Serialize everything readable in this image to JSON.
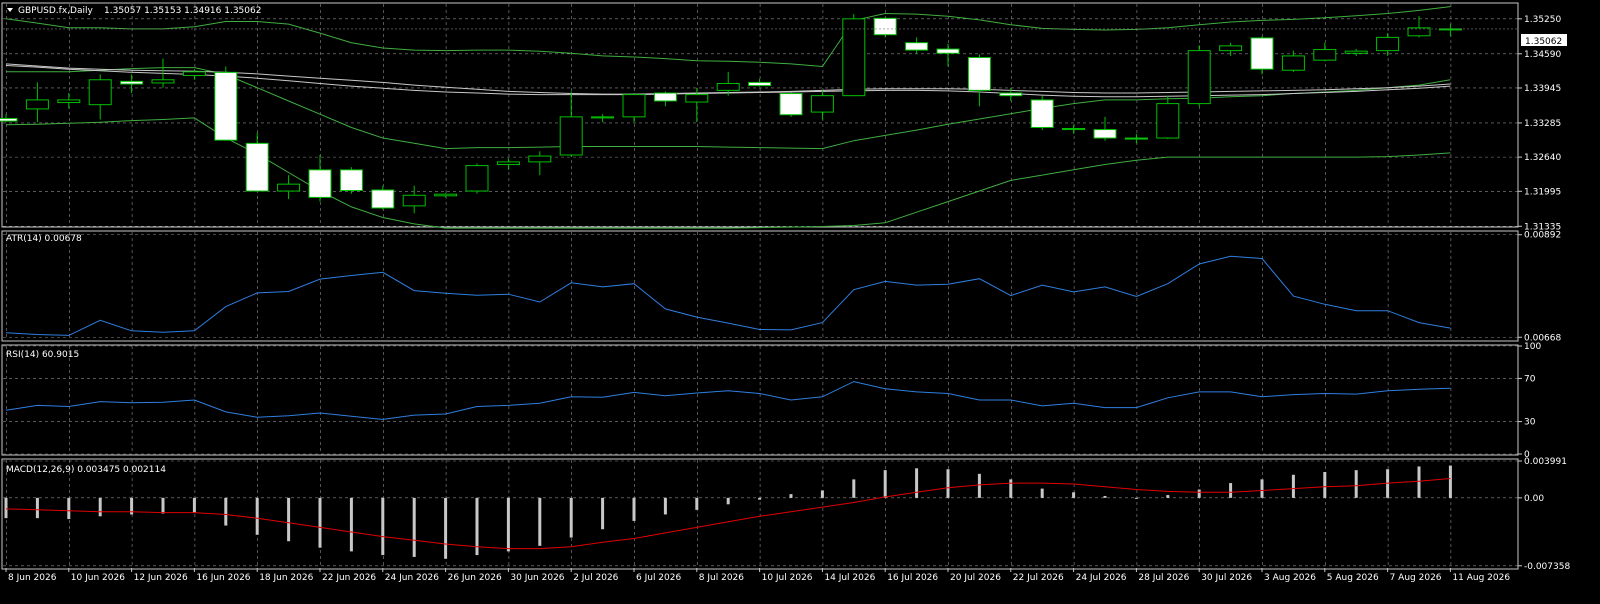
{
  "symbol_header": "GBPUSD.fx,Daily",
  "ohlc_header": "1.35057 1.35153 1.34916 1.35062",
  "current_price_label": "1.35062",
  "colors": {
    "background": "#000000",
    "grid": "#8c8c8c",
    "frame": "#c8c8c8",
    "bull": "#000000",
    "bear": "#ffffff",
    "candle_line": "#00c000",
    "band": "#3fae3f",
    "ma_slow": "#c8c8c8",
    "atr": "#2f7fe0",
    "rsi": "#2f7fe0",
    "macd_hist": "#c8c8c8",
    "macd_signal": "#e00000",
    "text": "#ffffff"
  },
  "chart_data": [
    {
      "type": "candlestick",
      "name": "price",
      "title": "GBPUSD.fx,Daily",
      "y_ticks": [
        "1.35250",
        "1.34590",
        "1.33945",
        "1.33285",
        "1.32640",
        "1.31995",
        "1.31335"
      ],
      "ylim": [
        1.3134,
        1.3553
      ],
      "grid": true,
      "candles": [
        {
          "o": 1.3337,
          "h": 1.3345,
          "l": 1.333,
          "c": 1.3332
        },
        {
          "o": 1.3355,
          "h": 1.3405,
          "l": 1.333,
          "c": 1.3372
        },
        {
          "o": 1.3367,
          "h": 1.3385,
          "l": 1.3356,
          "c": 1.3372
        },
        {
          "o": 1.3363,
          "h": 1.342,
          "l": 1.3335,
          "c": 1.341
        },
        {
          "o": 1.3407,
          "h": 1.342,
          "l": 1.3385,
          "c": 1.3402
        },
        {
          "o": 1.3404,
          "h": 1.345,
          "l": 1.3395,
          "c": 1.341
        },
        {
          "o": 1.3418,
          "h": 1.343,
          "l": 1.341,
          "c": 1.3425
        },
        {
          "o": 1.3424,
          "h": 1.3435,
          "l": 1.3408,
          "c": 1.3296
        },
        {
          "o": 1.329,
          "h": 1.331,
          "l": 1.3225,
          "c": 1.32
        },
        {
          "o": 1.32,
          "h": 1.323,
          "l": 1.3185,
          "c": 1.3213
        },
        {
          "o": 1.324,
          "h": 1.3268,
          "l": 1.318,
          "c": 1.3188
        },
        {
          "o": 1.324,
          "h": 1.3245,
          "l": 1.3195,
          "c": 1.3201
        },
        {
          "o": 1.3202,
          "h": 1.321,
          "l": 1.3165,
          "c": 1.3168
        },
        {
          "o": 1.3172,
          "h": 1.321,
          "l": 1.3158,
          "c": 1.3192
        },
        {
          "o": 1.3191,
          "h": 1.3196,
          "l": 1.3188,
          "c": 1.3194
        },
        {
          "o": 1.32,
          "h": 1.3252,
          "l": 1.3195,
          "c": 1.3248
        },
        {
          "o": 1.325,
          "h": 1.3262,
          "l": 1.324,
          "c": 1.3255
        },
        {
          "o": 1.3255,
          "h": 1.3275,
          "l": 1.323,
          "c": 1.3266
        },
        {
          "o": 1.3268,
          "h": 1.3388,
          "l": 1.3265,
          "c": 1.334
        },
        {
          "o": 1.3338,
          "h": 1.3345,
          "l": 1.333,
          "c": 1.334
        },
        {
          "o": 1.334,
          "h": 1.3385,
          "l": 1.333,
          "c": 1.3382
        },
        {
          "o": 1.3385,
          "h": 1.3388,
          "l": 1.336,
          "c": 1.337
        },
        {
          "o": 1.3368,
          "h": 1.3395,
          "l": 1.333,
          "c": 1.3382
        },
        {
          "o": 1.339,
          "h": 1.3425,
          "l": 1.338,
          "c": 1.3403
        },
        {
          "o": 1.3405,
          "h": 1.3412,
          "l": 1.3397,
          "c": 1.3399
        },
        {
          "o": 1.3384,
          "h": 1.3386,
          "l": 1.334,
          "c": 1.3344
        },
        {
          "o": 1.3349,
          "h": 1.339,
          "l": 1.3335,
          "c": 1.338
        },
        {
          "o": 1.338,
          "h": 1.3534,
          "l": 1.3379,
          "c": 1.3525
        },
        {
          "o": 1.3526,
          "h": 1.3528,
          "l": 1.349,
          "c": 1.3495
        },
        {
          "o": 1.348,
          "h": 1.349,
          "l": 1.346,
          "c": 1.3466
        },
        {
          "o": 1.3468,
          "h": 1.3478,
          "l": 1.3435,
          "c": 1.346
        },
        {
          "o": 1.3452,
          "h": 1.3458,
          "l": 1.336,
          "c": 1.339
        },
        {
          "o": 1.3385,
          "h": 1.3395,
          "l": 1.337,
          "c": 1.338
        },
        {
          "o": 1.3372,
          "h": 1.338,
          "l": 1.3315,
          "c": 1.332
        },
        {
          "o": 1.3316,
          "h": 1.3325,
          "l": 1.3308,
          "c": 1.3318
        },
        {
          "o": 1.3316,
          "h": 1.334,
          "l": 1.3295,
          "c": 1.33
        },
        {
          "o": 1.33,
          "h": 1.3308,
          "l": 1.329,
          "c": 1.3298
        },
        {
          "o": 1.33,
          "h": 1.338,
          "l": 1.3298,
          "c": 1.3365
        },
        {
          "o": 1.3365,
          "h": 1.3475,
          "l": 1.336,
          "c": 1.3465
        },
        {
          "o": 1.3465,
          "h": 1.348,
          "l": 1.3455,
          "c": 1.3474
        },
        {
          "o": 1.3489,
          "h": 1.3492,
          "l": 1.342,
          "c": 1.343
        },
        {
          "o": 1.3428,
          "h": 1.3465,
          "l": 1.3425,
          "c": 1.3455
        },
        {
          "o": 1.3447,
          "h": 1.348,
          "l": 1.3445,
          "c": 1.3467
        },
        {
          "o": 1.346,
          "h": 1.3468,
          "l": 1.3455,
          "c": 1.3464
        },
        {
          "o": 1.3465,
          "h": 1.3498,
          "l": 1.3455,
          "c": 1.349
        },
        {
          "o": 1.3493,
          "h": 1.353,
          "l": 1.349,
          "c": 1.3508
        },
        {
          "o": 1.3506,
          "h": 1.3515,
          "l": 1.3492,
          "c": 1.3506
        }
      ],
      "bands": {
        "upper": [
          1.3525,
          1.3517,
          1.3508,
          1.3508,
          1.3506,
          1.3506,
          1.351,
          1.352,
          1.352,
          1.3515,
          1.3498,
          1.348,
          1.347,
          1.3466,
          1.3465,
          1.3466,
          1.3466,
          1.3464,
          1.346,
          1.3455,
          1.3453,
          1.345,
          1.3446,
          1.3445,
          1.3443,
          1.344,
          1.3435,
          1.3522,
          1.3535,
          1.3534,
          1.353,
          1.3523,
          1.3514,
          1.3507,
          1.3505,
          1.3504,
          1.3505,
          1.3508,
          1.3514,
          1.3519,
          1.3522,
          1.3524,
          1.3527,
          1.3531,
          1.3535,
          1.3541,
          1.3548
        ],
        "middle": [
          1.3425,
          1.3425,
          1.3425,
          1.3428,
          1.3431,
          1.3433,
          1.3433,
          1.342,
          1.3395,
          1.337,
          1.3345,
          1.332,
          1.33,
          1.329,
          1.328,
          1.3282,
          1.3282,
          1.3283,
          1.3284,
          1.3284,
          1.3284,
          1.3284,
          1.3284,
          1.3283,
          1.3282,
          1.3281,
          1.328,
          1.3295,
          1.3305,
          1.3315,
          1.3326,
          1.3336,
          1.3346,
          1.3356,
          1.3365,
          1.3372,
          1.3372,
          1.3374,
          1.3375,
          1.3378,
          1.338,
          1.3384,
          1.3387,
          1.339,
          1.3395,
          1.34,
          1.341
        ],
        "lower": [
          1.3325,
          1.3326,
          1.3328,
          1.333,
          1.3333,
          1.3335,
          1.3338,
          1.33,
          1.327,
          1.3235,
          1.32,
          1.317,
          1.315,
          1.3138,
          1.313,
          1.313,
          1.313,
          1.313,
          1.313,
          1.313,
          1.313,
          1.313,
          1.313,
          1.313,
          1.3131,
          1.3132,
          1.3133,
          1.3135,
          1.314,
          1.316,
          1.318,
          1.32,
          1.322,
          1.323,
          1.324,
          1.325,
          1.3258,
          1.3264,
          1.3264,
          1.3264,
          1.3264,
          1.3264,
          1.3264,
          1.3264,
          1.3265,
          1.3268,
          1.3272
        ]
      },
      "ma_slow": [
        1.344,
        1.3436,
        1.3432,
        1.343,
        1.3428,
        1.3427,
        1.3426,
        1.3424,
        1.3421,
        1.3417,
        1.3413,
        1.3409,
        1.3405,
        1.34,
        1.3396,
        1.3392,
        1.3388,
        1.3386,
        1.3384,
        1.3383,
        1.3383,
        1.3384,
        1.3385,
        1.3386,
        1.3387,
        1.3388,
        1.339,
        1.3392,
        1.3393,
        1.3393,
        1.3393,
        1.3392,
        1.339,
        1.3388,
        1.3386,
        1.3385,
        1.3385,
        1.3386,
        1.3387,
        1.3388,
        1.3389,
        1.339,
        1.3391,
        1.3393,
        1.3395,
        1.3398,
        1.3402
      ],
      "ma_slow2": [
        1.3437,
        1.3434,
        1.343,
        1.3427,
        1.3424,
        1.3422,
        1.342,
        1.3417,
        1.3413,
        1.3408,
        1.3403,
        1.3398,
        1.3394,
        1.339,
        1.3387,
        1.3385,
        1.3383,
        1.3382,
        1.3382,
        1.3382,
        1.3382,
        1.3383,
        1.3384,
        1.3385,
        1.3386,
        1.3387,
        1.3388,
        1.3389,
        1.339,
        1.339,
        1.3389,
        1.3387,
        1.3384,
        1.3381,
        1.3379,
        1.3378,
        1.3378,
        1.3379,
        1.338,
        1.3381,
        1.3382,
        1.3384,
        1.3386,
        1.3388,
        1.3391,
        1.3394,
        1.3398
      ]
    },
    {
      "type": "line",
      "name": "ATR",
      "title": "ATR(14) 0.00678",
      "y_ticks": [
        "0.00892",
        "0.00668"
      ],
      "ylim": [
        0.00662,
        0.00898
      ],
      "series": [
        {
          "name": "ATR(14)",
          "values": [
            0.00678,
            0.00674,
            0.00672,
            0.00705,
            0.00682,
            0.00679,
            0.00682,
            0.00735,
            0.00765,
            0.00768,
            0.00795,
            0.00803,
            0.0081,
            0.0077,
            0.00764,
            0.0076,
            0.00762,
            0.00745,
            0.00787,
            0.00778,
            0.00785,
            0.0073,
            0.00712,
            0.00699,
            0.00685,
            0.00684,
            0.007,
            0.00772,
            0.0079,
            0.00782,
            0.00784,
            0.00796,
            0.00759,
            0.00782,
            0.00767,
            0.00778,
            0.00757,
            0.00785,
            0.00828,
            0.00845,
            0.0084,
            0.00758,
            0.0074,
            0.00726,
            0.00726,
            0.007,
            0.00688
          ]
        }
      ]
    },
    {
      "type": "line",
      "name": "RSI",
      "title": "RSI(14) 60.9015",
      "y_ticks": [
        "100",
        "70",
        "30",
        "0"
      ],
      "ylim": [
        0,
        100
      ],
      "series": [
        {
          "name": "RSI(14)",
          "values": [
            40.5,
            45,
            44,
            48.5,
            47.5,
            48,
            50,
            39,
            34,
            35.5,
            38,
            35,
            32,
            36,
            37,
            44,
            45,
            47,
            53,
            52.5,
            57,
            54,
            56.5,
            58.5,
            56,
            50,
            53,
            67,
            60.5,
            57.5,
            56,
            50,
            50,
            44.5,
            47,
            43,
            43,
            52,
            57.5,
            57.5,
            53,
            55,
            56,
            55.5,
            58.5,
            60,
            60.9
          ]
        }
      ]
    },
    {
      "type": "bar",
      "name": "MACD",
      "title": "MACD(12,26,9) 0.003475 0.002114",
      "y_ticks": [
        "0.003991",
        "0.00",
        "-0.007358"
      ],
      "ylim": [
        -0.0076,
        0.0041
      ],
      "series": [
        {
          "name": "MACD",
          "values": [
            -0.0022,
            -0.0022,
            -0.0023,
            -0.002,
            -0.0018,
            -0.0017,
            -0.0016,
            -0.003,
            -0.004,
            -0.0047,
            -0.0054,
            -0.0058,
            -0.0062,
            -0.0064,
            -0.0066,
            -0.0062,
            -0.0058,
            -0.0052,
            -0.0043,
            -0.0034,
            -0.0025,
            -0.0018,
            -0.0013,
            -0.0007,
            -0.0002,
            0.0004,
            0.0008,
            0.002,
            0.003,
            0.0032,
            0.0031,
            0.0026,
            0.002,
            0.001,
            0.0006,
            0.0002,
            -0.0001,
            0.0003,
            0.0009,
            0.0016,
            0.002,
            0.0025,
            0.0028,
            0.003,
            0.0031,
            0.0034,
            0.0035
          ]
        },
        {
          "name": "Signal",
          "values": [
            -0.0012,
            -0.0013,
            -0.0014,
            -0.0015,
            -0.0015,
            -0.0016,
            -0.0016,
            -0.0018,
            -0.0022,
            -0.0027,
            -0.0032,
            -0.0037,
            -0.0042,
            -0.0046,
            -0.005,
            -0.0053,
            -0.0055,
            -0.0055,
            -0.0053,
            -0.0048,
            -0.0044,
            -0.0038,
            -0.0032,
            -0.0026,
            -0.002,
            -0.0015,
            -0.001,
            -0.0005,
            0.0001,
            0.0006,
            0.0011,
            0.0014,
            0.0016,
            0.0016,
            0.0015,
            0.0012,
            0.0009,
            0.0007,
            0.0006,
            0.0006,
            0.0008,
            0.001,
            0.0012,
            0.0013,
            0.0016,
            0.0018,
            0.0021
          ]
        }
      ]
    }
  ],
  "x_labels": [
    {
      "idx": 0,
      "label": "8 Jun 2026"
    },
    {
      "idx": 2,
      "label": "10 Jun 2026"
    },
    {
      "idx": 4,
      "label": "12 Jun 2026"
    },
    {
      "idx": 6,
      "label": "16 Jun 2026"
    },
    {
      "idx": 8,
      "label": "18 Jun 2026"
    },
    {
      "idx": 10,
      "label": "22 Jun 2026"
    },
    {
      "idx": 12,
      "label": "24 Jun 2026"
    },
    {
      "idx": 14,
      "label": "26 Jun 2026"
    },
    {
      "idx": 16,
      "label": "30 Jun 2026"
    },
    {
      "idx": 18,
      "label": "2 Jul 2026"
    },
    {
      "idx": 20,
      "label": "6 Jul 2026"
    },
    {
      "idx": 22,
      "label": "8 Jul 2026"
    },
    {
      "idx": 24,
      "label": "10 Jul 2026"
    },
    {
      "idx": 26,
      "label": "14 Jul 2026"
    },
    {
      "idx": 28,
      "label": "16 Jul 2026"
    },
    {
      "idx": 30,
      "label": "20 Jul 2026"
    },
    {
      "idx": 32,
      "label": "22 Jul 2026"
    },
    {
      "idx": 34,
      "label": "24 Jul 2026"
    },
    {
      "idx": 36,
      "label": "28 Jul 2026"
    },
    {
      "idx": 38,
      "label": "30 Jul 2026"
    },
    {
      "idx": 40,
      "label": "3 Aug 2026"
    },
    {
      "idx": 42,
      "label": "5 Aug 2026"
    },
    {
      "idx": 44,
      "label": "7 Aug 2026"
    },
    {
      "idx": 46,
      "label": "11 Aug 2026"
    }
  ]
}
